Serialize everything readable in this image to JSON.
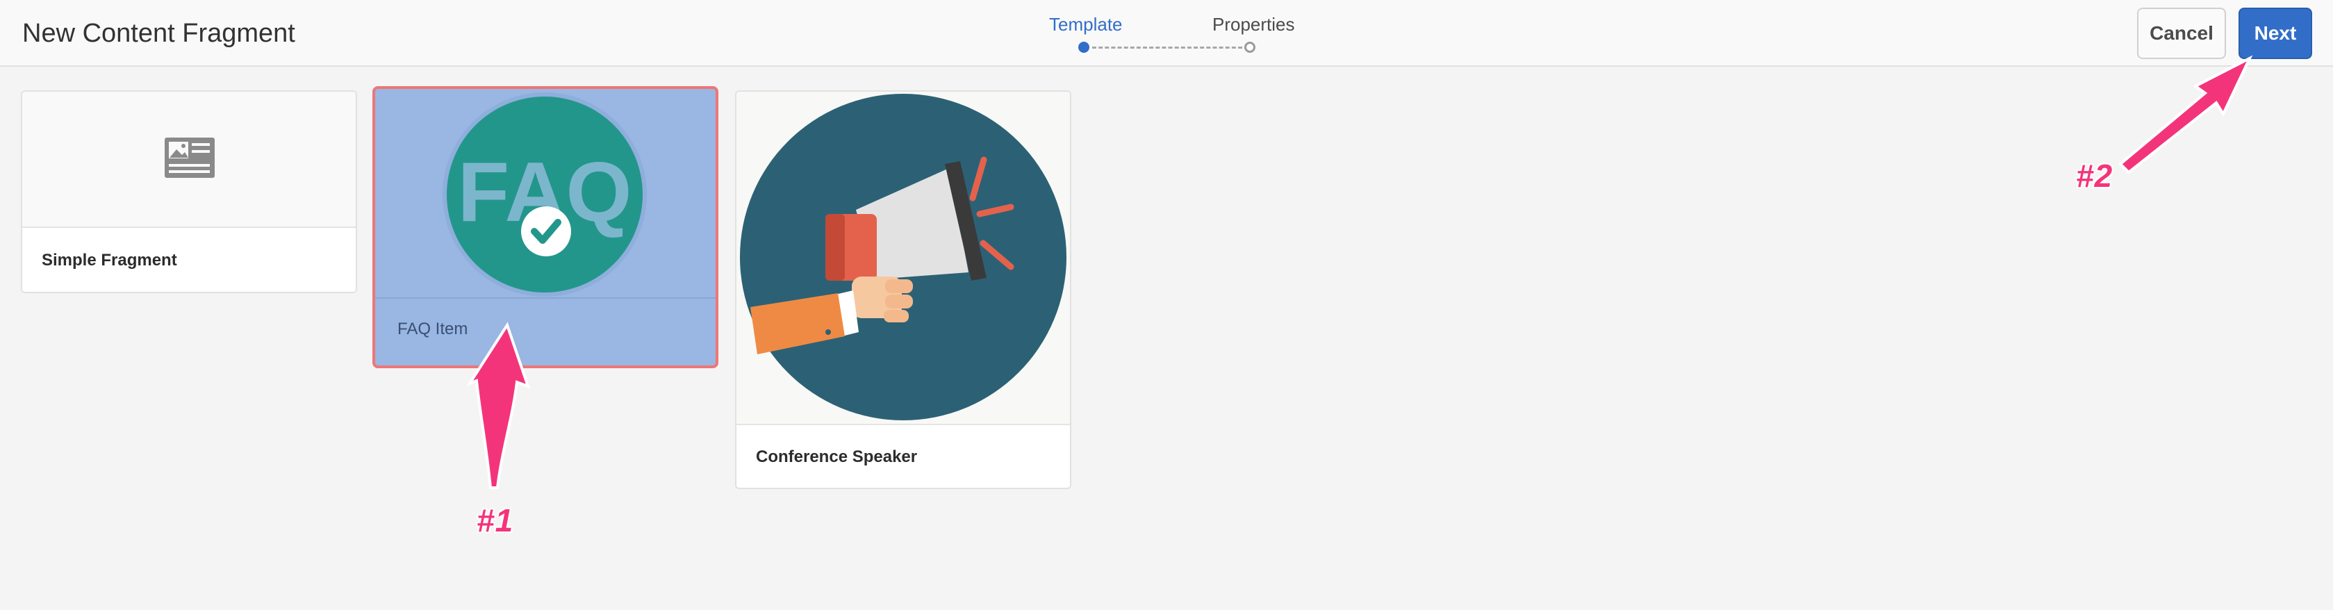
{
  "header": {
    "title": "New Content Fragment",
    "cancel_label": "Cancel",
    "next_label": "Next"
  },
  "wizard": {
    "steps": [
      {
        "label": "Template",
        "state": "current"
      },
      {
        "label": "Properties",
        "state": "upcoming"
      }
    ]
  },
  "templates": [
    {
      "title": "Simple Fragment",
      "thumbnail_icon": "document-card-icon",
      "selected": false
    },
    {
      "title": "FAQ Item",
      "thumbnail_icon": "faq-badge-icon",
      "selected": true
    },
    {
      "title": "Conference Speaker",
      "thumbnail_icon": "megaphone-icon",
      "selected": false
    }
  ],
  "faq_badge_text": "FAQ",
  "annotations": [
    {
      "label": "#1",
      "icon": "arrow-up-icon"
    },
    {
      "label": "#2",
      "icon": "arrow-up-right-icon"
    }
  ],
  "colors": {
    "accent": "#326ec8",
    "selection_fill": "#9ab6e2",
    "selection_border": "#ee7676",
    "annotation": "#f4347a",
    "faq_circle": "#23968c",
    "megaphone_circle": "#2c6175"
  }
}
